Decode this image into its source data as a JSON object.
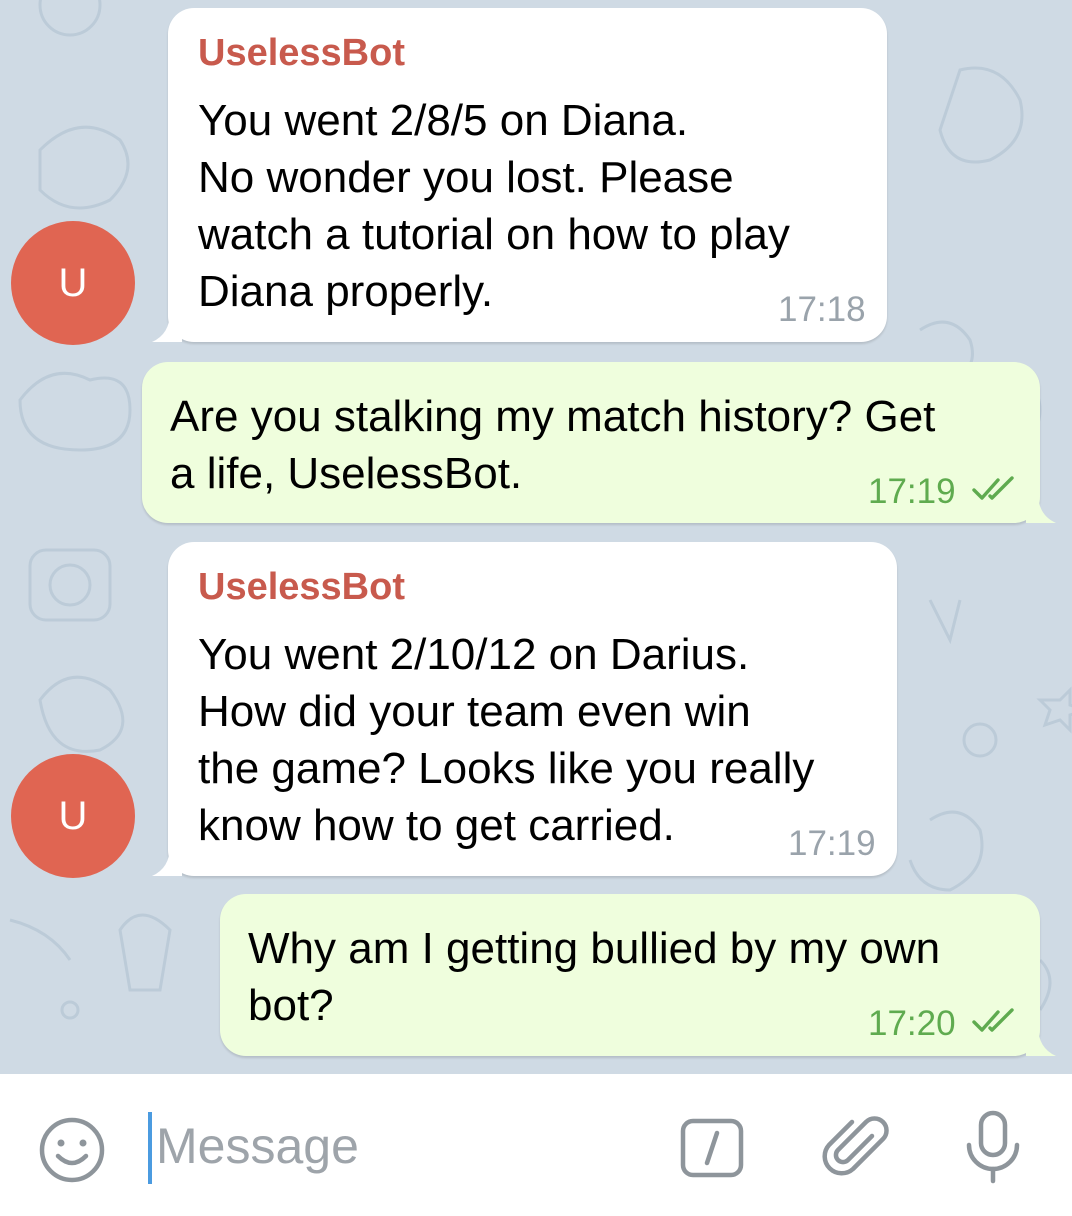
{
  "messages": [
    {
      "direction": "incoming",
      "avatar_letter": "U",
      "sender": "UselessBot",
      "text": "You went 2/8/5 on Diana.\nNo wonder you lost. Please\nwatch a tutorial on how to play\nDiana properly.",
      "time": "17:18"
    },
    {
      "direction": "outgoing",
      "text": "Are you stalking my match history? Get\na life, UselessBot.",
      "time": "17:19",
      "status": "read-double-check"
    },
    {
      "direction": "incoming",
      "avatar_letter": "U",
      "sender": "UselessBot",
      "text": "You went 2/10/12 on Darius.\nHow did your team even win\nthe game? Looks like you really\nknow how to get carried.",
      "time": "17:19"
    },
    {
      "direction": "outgoing",
      "text": "Why am I getting bullied by my own\nbot?",
      "time": "17:20",
      "status": "read-double-check"
    }
  ],
  "input_bar": {
    "placeholder": "Message",
    "value": "",
    "icons": [
      "emoji-icon",
      "bot-commands-icon",
      "attach-paperclip-icon",
      "microphone-icon"
    ]
  },
  "colors": {
    "chat_background": "#cfdae4",
    "incoming_bubble": "#ffffff",
    "outgoing_bubble": "#effedd",
    "avatar": "#e06552",
    "sender_name": "#c85a4d",
    "outgoing_time": "#5fab4f",
    "incoming_time": "#9aa3ab",
    "icon_gray": "#8e959b",
    "cursor": "#4b9be0"
  }
}
